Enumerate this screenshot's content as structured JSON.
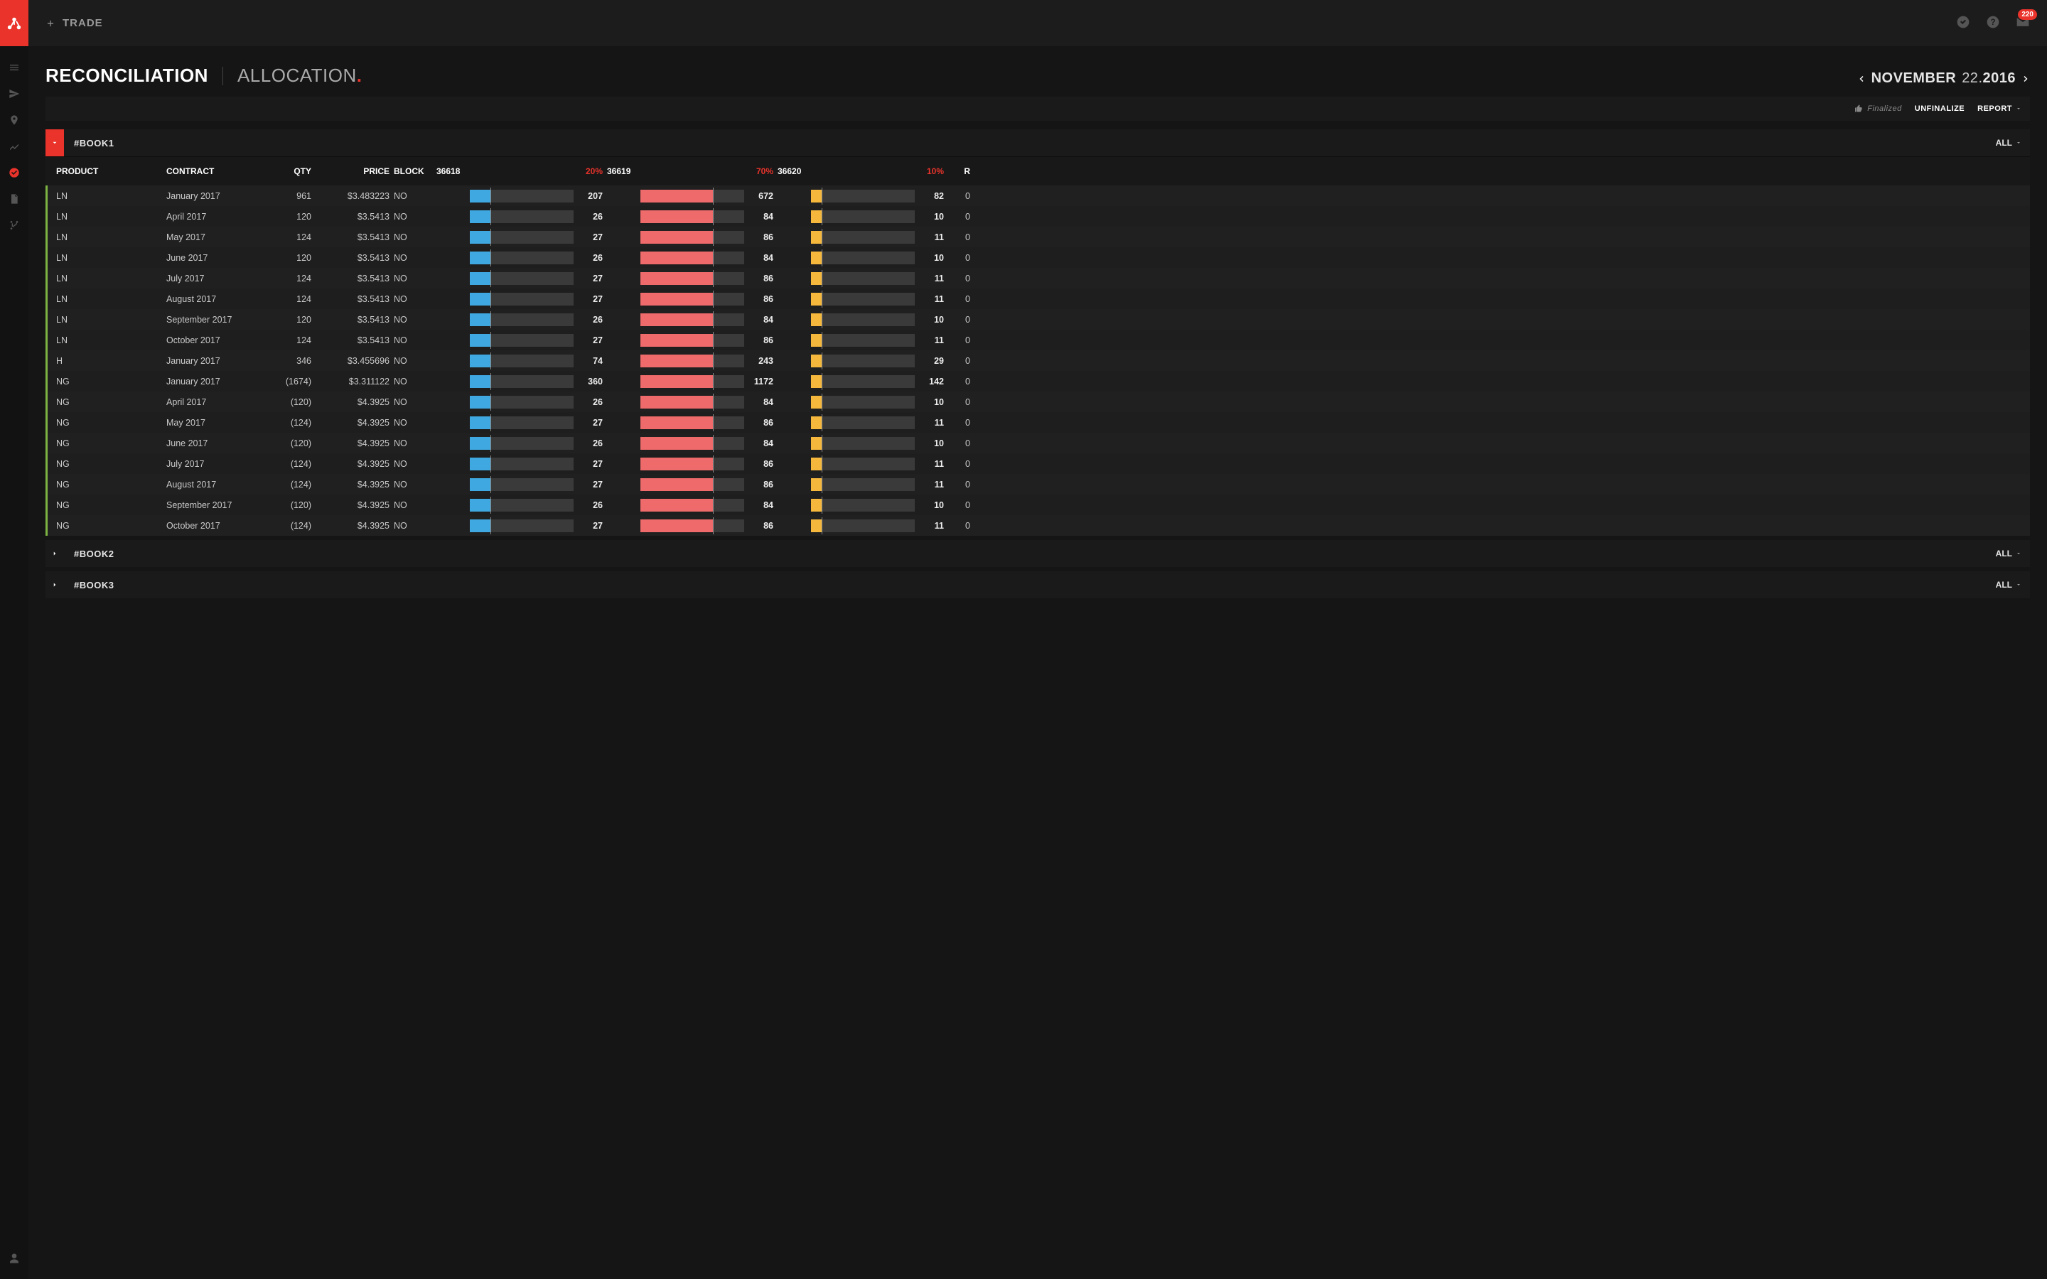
{
  "topbar": {
    "trade_label": "TRADE",
    "inbox_count": "220"
  },
  "page": {
    "tab_reconciliation": "RECONCILIATION",
    "tab_allocation": "ALLOCATION",
    "date_month": "NOVEMBER",
    "date_day": "22",
    "date_year": "2016"
  },
  "actions": {
    "finalized": "Finalized",
    "unfinalize": "UNFINALIZE",
    "report": "REPORT"
  },
  "filter_all": "ALL",
  "columns": {
    "product": "PRODUCT",
    "contract": "CONTRACT",
    "qty": "QTY",
    "price": "PRICE",
    "block": "BLOCK",
    "r": "R"
  },
  "allocs": [
    {
      "id": "36618",
      "pct": "20%",
      "color": "blue"
    },
    {
      "id": "36619",
      "pct": "70%",
      "color": "red"
    },
    {
      "id": "36620",
      "pct": "10%",
      "color": "yellow"
    }
  ],
  "books": [
    {
      "name": "#BOOK1",
      "expanded": true,
      "rows": [
        {
          "product": "LN",
          "contract": "January 2017",
          "qty": "961",
          "price": "$3.483223",
          "block": "NO",
          "a1": "207",
          "a2": "672",
          "a3": "82",
          "r": "0"
        },
        {
          "product": "LN",
          "contract": "April 2017",
          "qty": "120",
          "price": "$3.5413",
          "block": "NO",
          "a1": "26",
          "a2": "84",
          "a3": "10",
          "r": "0"
        },
        {
          "product": "LN",
          "contract": "May 2017",
          "qty": "124",
          "price": "$3.5413",
          "block": "NO",
          "a1": "27",
          "a2": "86",
          "a3": "11",
          "r": "0"
        },
        {
          "product": "LN",
          "contract": "June 2017",
          "qty": "120",
          "price": "$3.5413",
          "block": "NO",
          "a1": "26",
          "a2": "84",
          "a3": "10",
          "r": "0"
        },
        {
          "product": "LN",
          "contract": "July 2017",
          "qty": "124",
          "price": "$3.5413",
          "block": "NO",
          "a1": "27",
          "a2": "86",
          "a3": "11",
          "r": "0"
        },
        {
          "product": "LN",
          "contract": "August 2017",
          "qty": "124",
          "price": "$3.5413",
          "block": "NO",
          "a1": "27",
          "a2": "86",
          "a3": "11",
          "r": "0"
        },
        {
          "product": "LN",
          "contract": "September 2017",
          "qty": "120",
          "price": "$3.5413",
          "block": "NO",
          "a1": "26",
          "a2": "84",
          "a3": "10",
          "r": "0"
        },
        {
          "product": "LN",
          "contract": "October 2017",
          "qty": "124",
          "price": "$3.5413",
          "block": "NO",
          "a1": "27",
          "a2": "86",
          "a3": "11",
          "r": "0"
        },
        {
          "product": "H",
          "contract": "January 2017",
          "qty": "346",
          "price": "$3.455696",
          "block": "NO",
          "a1": "74",
          "a2": "243",
          "a3": "29",
          "r": "0"
        },
        {
          "product": "NG",
          "contract": "January 2017",
          "qty": "(1674)",
          "price": "$3.311122",
          "block": "NO",
          "a1": "360",
          "a2": "1172",
          "a3": "142",
          "r": "0"
        },
        {
          "product": "NG",
          "contract": "April 2017",
          "qty": "(120)",
          "price": "$4.3925",
          "block": "NO",
          "a1": "26",
          "a2": "84",
          "a3": "10",
          "r": "0"
        },
        {
          "product": "NG",
          "contract": "May 2017",
          "qty": "(124)",
          "price": "$4.3925",
          "block": "NO",
          "a1": "27",
          "a2": "86",
          "a3": "11",
          "r": "0"
        },
        {
          "product": "NG",
          "contract": "June 2017",
          "qty": "(120)",
          "price": "$4.3925",
          "block": "NO",
          "a1": "26",
          "a2": "84",
          "a3": "10",
          "r": "0"
        },
        {
          "product": "NG",
          "contract": "July 2017",
          "qty": "(124)",
          "price": "$4.3925",
          "block": "NO",
          "a1": "27",
          "a2": "86",
          "a3": "11",
          "r": "0"
        },
        {
          "product": "NG",
          "contract": "August 2017",
          "qty": "(124)",
          "price": "$4.3925",
          "block": "NO",
          "a1": "27",
          "a2": "86",
          "a3": "11",
          "r": "0"
        },
        {
          "product": "NG",
          "contract": "September 2017",
          "qty": "(120)",
          "price": "$4.3925",
          "block": "NO",
          "a1": "26",
          "a2": "84",
          "a3": "10",
          "r": "0"
        },
        {
          "product": "NG",
          "contract": "October 2017",
          "qty": "(124)",
          "price": "$4.3925",
          "block": "NO",
          "a1": "27",
          "a2": "86",
          "a3": "11",
          "r": "0"
        }
      ]
    },
    {
      "name": "#BOOK2",
      "expanded": false
    },
    {
      "name": "#BOOK3",
      "expanded": false
    }
  ]
}
